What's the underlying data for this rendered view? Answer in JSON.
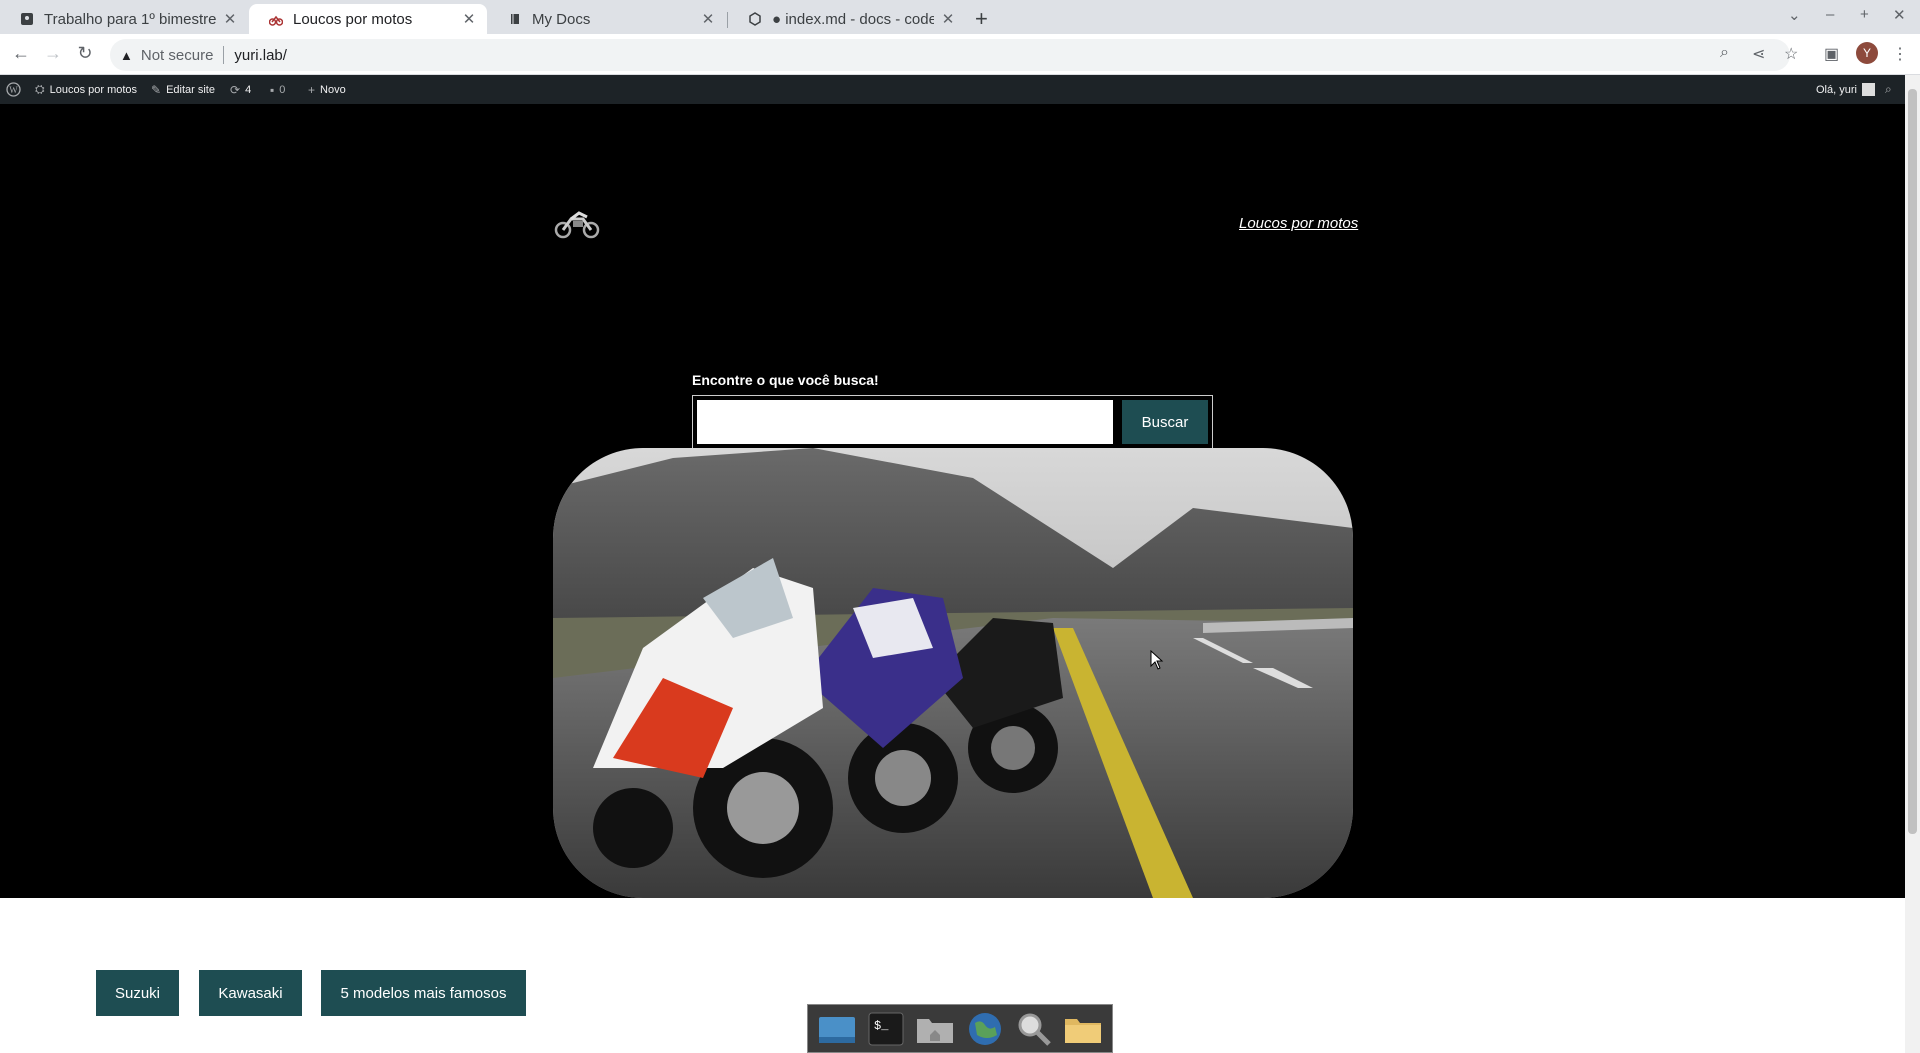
{
  "browser": {
    "tabs": [
      {
        "title": "Trabalho para 1º bimestre",
        "active": false
      },
      {
        "title": "Loucos por motos",
        "active": true
      },
      {
        "title": "My Docs",
        "active": false
      },
      {
        "title": "● index.md - docs - code-",
        "active": false
      }
    ],
    "security_label": "Not secure",
    "url": "yuri.lab/",
    "avatar_letter": "Y"
  },
  "wp_admin_bar": {
    "site_name": "Loucos por motos",
    "edit_site": "Editar site",
    "updates_count": "4",
    "comments_count": "0",
    "new_label": "Novo",
    "greeting": "Olá, yuri"
  },
  "site": {
    "title_link": "Loucos por motos",
    "search_label": "Encontre o que você busca!",
    "search_placeholder": "",
    "search_button": "Buscar",
    "hero_image": "three-sport-motorcycles-on-road",
    "categories": [
      "Suzuki",
      "Kawasaki",
      "5 modelos mais famosos"
    ],
    "accent_color": "#1e4d52"
  },
  "dock": {
    "items": [
      "desktop-icon",
      "terminal-icon",
      "home-folder-icon",
      "browser-globe-icon",
      "search-magnifier-icon",
      "files-folder-icon"
    ]
  }
}
